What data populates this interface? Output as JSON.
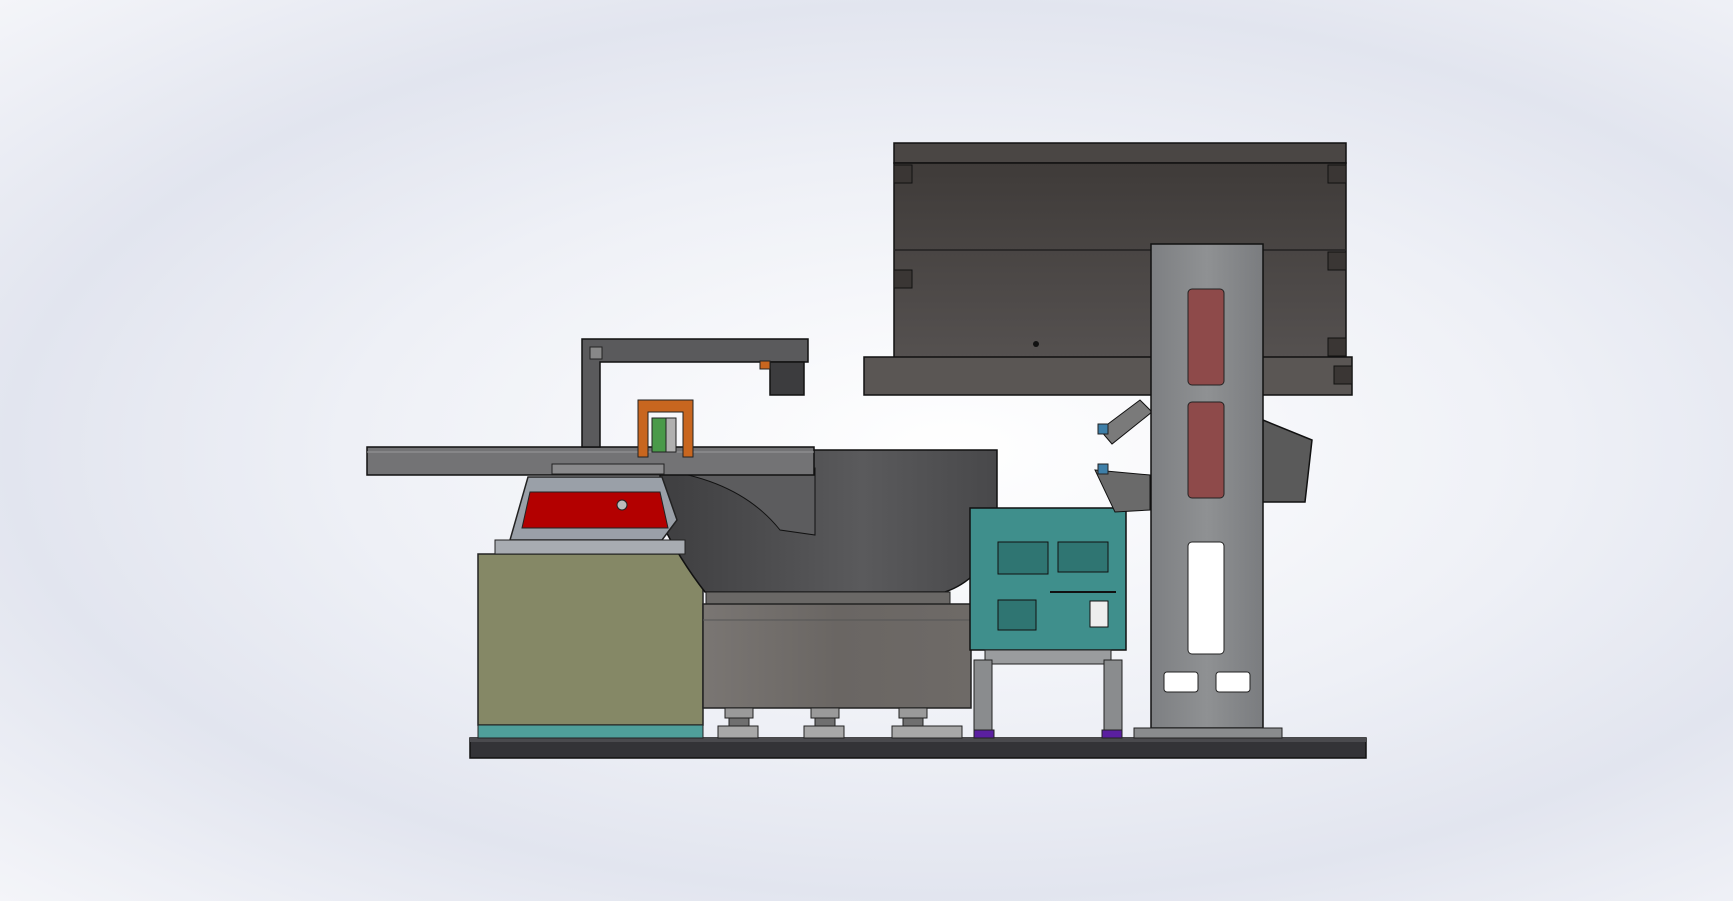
{
  "scene": {
    "kind": "cad-assembly-side-view",
    "background": "#eef0f6",
    "components": [
      {
        "name": "base-plate",
        "color": "#3a3a3e"
      },
      {
        "name": "electrical-cabinet",
        "color": "#858866"
      },
      {
        "name": "vibratory-bowl",
        "color": "#4a4a4c"
      },
      {
        "name": "linear-feeder-track",
        "color": "#6e6e70"
      },
      {
        "name": "linear-vibrator-plate",
        "color": "#b30000"
      },
      {
        "name": "orange-bracket",
        "color": "#c8661f"
      },
      {
        "name": "camera-sensor",
        "color": "#3c3c3e"
      },
      {
        "name": "controller-box",
        "color": "#3f8f8c"
      },
      {
        "name": "hopper",
        "color": "#4a4644"
      },
      {
        "name": "support-column",
        "color": "#8a8c8e"
      },
      {
        "name": "column-window",
        "color": "#8e4a4a"
      },
      {
        "name": "tilted-drive-unit",
        "color": "#5a5a5a"
      },
      {
        "name": "purple-feet",
        "color": "#5a1fa0"
      },
      {
        "name": "cabinet-teal-strip",
        "color": "#4f9f9a"
      }
    ]
  }
}
